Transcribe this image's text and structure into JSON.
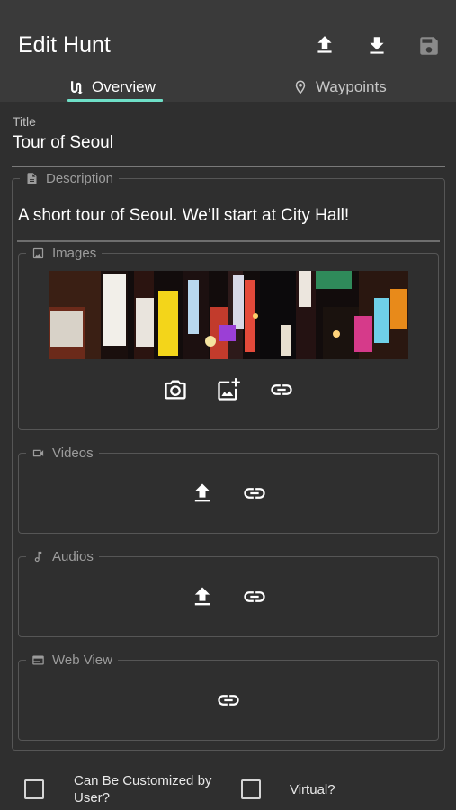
{
  "header": {
    "title": "Edit Hunt",
    "actions": [
      {
        "name": "upload-icon"
      },
      {
        "name": "download-icon"
      },
      {
        "name": "save-icon"
      }
    ]
  },
  "tabs": [
    {
      "label": "Overview",
      "icon": "route-icon",
      "selected": true
    },
    {
      "label": "Waypoints",
      "icon": "location-pin-icon",
      "selected": false
    }
  ],
  "colors": {
    "tab_indicator": "#6fe0c8",
    "background": "#2f2f2f",
    "appbar": "#3a3a3a"
  },
  "title_field": {
    "label": "Title",
    "value": "Tour of Seoul"
  },
  "description": {
    "legend": "Description",
    "value": "A short tour of Seoul.  We’ll start at City Hall!"
  },
  "images": {
    "legend": "Images",
    "actions": [
      "camera-icon",
      "add-photo-icon",
      "link-icon"
    ]
  },
  "videos": {
    "legend": "Videos",
    "actions": [
      "upload-icon",
      "link-icon"
    ]
  },
  "audios": {
    "legend": "Audios",
    "actions": [
      "upload-icon",
      "link-icon"
    ]
  },
  "web_view": {
    "legend": "Web View",
    "actions": [
      "link-icon"
    ]
  },
  "options": {
    "customizable_label": "Can Be Customized by User?",
    "customizable_checked": false,
    "virtual_label": "Virtual?",
    "virtual_checked": false
  }
}
